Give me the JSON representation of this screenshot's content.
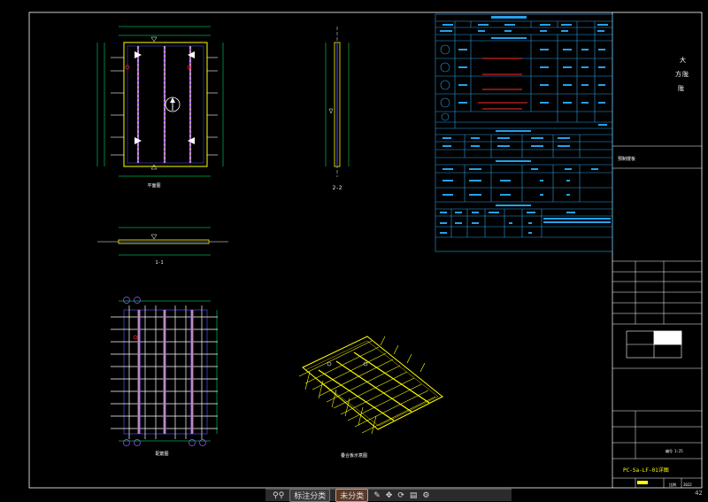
{
  "colors": {
    "background": "#000000",
    "frame": "#ffffff",
    "table": "#27a0e8",
    "rebar": "#ffff00",
    "slab": "#4444dd",
    "dimension": "#00ff7f",
    "highlight": "#ff2a2a",
    "purple": "#9c5cff"
  },
  "title_block": {
    "right_upper_text": "大\n方\n陇",
    "mid_label": "预制楼板",
    "drawing_name": "PC-Sa-LF-01详图",
    "scale_label": "比例",
    "scale_value": "1:25",
    "sheet_label": "编号",
    "date_value": "2022"
  },
  "drawing_labels": {
    "plan_view": "平面图",
    "section_2_2": "2-2",
    "section_1_1": "1-1",
    "rebar_plan": "配筋图",
    "iso_view": "叠合板示意图"
  },
  "bottom_bar": {
    "zoom_icon": "zoom-icon",
    "tab1": "标注分类",
    "tab2": "未分类",
    "page_number": "42"
  }
}
